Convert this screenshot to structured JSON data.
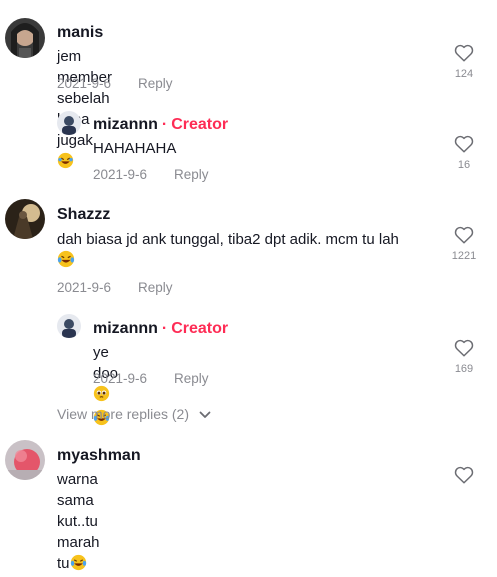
{
  "comments": [
    {
      "username": "manis",
      "text": "jem member sebelah kena jugak",
      "emoji": "rofl-emoji",
      "date": "2021-9-6",
      "reply_label": "Reply",
      "likes": "124"
    },
    {
      "username": "mizannn",
      "badge_sep": "·",
      "badge": "Creator",
      "text": "HAHAHAHA",
      "date": "2021-9-6",
      "reply_label": "Reply",
      "likes": "16"
    },
    {
      "username": "Shazzz",
      "text": "dah biasa jd ank tunggal, tiba2 dpt adik. mcm tu lah",
      "emoji": "tears-of-joy-emoji",
      "date": "2021-9-6",
      "reply_label": "Reply",
      "likes": "1221"
    },
    {
      "username": "mizannn",
      "badge_sep": "·",
      "badge": "Creator",
      "text": "ye doo",
      "emoji": [
        "pleading-emoji",
        "tears-of-joy-emoji"
      ],
      "date": "2021-9-6",
      "reply_label": "Reply",
      "likes": "169"
    },
    {
      "username": "myashman",
      "text": "warna sama kut..tu marah tu",
      "emoji": "tears-of-joy-emoji",
      "likes": ""
    }
  ],
  "view_more": "View more replies (2)",
  "icons": {
    "like": "heart-outline-icon",
    "expand": "chevron-down-icon"
  },
  "colors": {
    "creator": "#fe2c55",
    "meta": "#8a8b91",
    "text": "#161823"
  }
}
